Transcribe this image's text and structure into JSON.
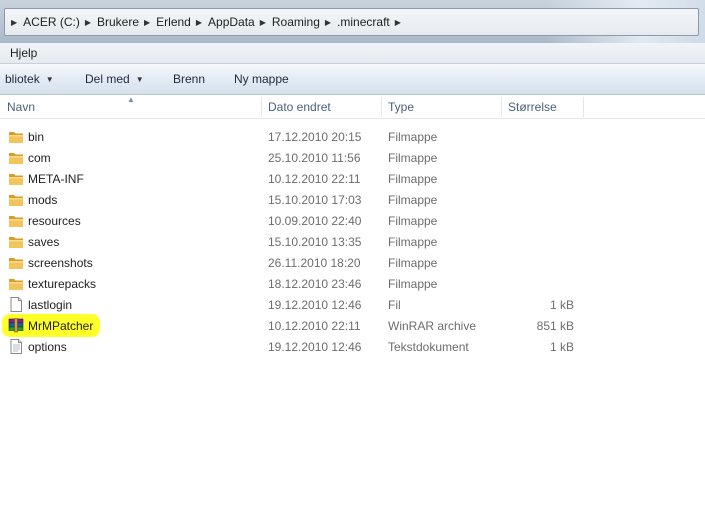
{
  "address_bar": {
    "crumbs": [
      "ACER (C:)",
      "Brukere",
      "Erlend",
      "AppData",
      "Roaming",
      ".minecraft"
    ]
  },
  "menu": {
    "items": [
      "Hjelp"
    ]
  },
  "toolbar": {
    "library_label": "bliotek",
    "share_label": "Del med",
    "burn_label": "Brenn",
    "new_folder_label": "Ny mappe"
  },
  "columns": {
    "name": "Navn",
    "date": "Dato endret",
    "type": "Type",
    "size": "Størrelse"
  },
  "files": [
    {
      "name": "bin",
      "date": "17.12.2010 20:15",
      "type": "Filmappe",
      "size": "",
      "icon": "folder-icon"
    },
    {
      "name": "com",
      "date": "25.10.2010 11:56",
      "type": "Filmappe",
      "size": "",
      "icon": "folder-icon"
    },
    {
      "name": "META-INF",
      "date": "10.12.2010 22:11",
      "type": "Filmappe",
      "size": "",
      "icon": "folder-icon"
    },
    {
      "name": "mods",
      "date": "15.10.2010 17:03",
      "type": "Filmappe",
      "size": "",
      "icon": "folder-icon"
    },
    {
      "name": "resources",
      "date": "10.09.2010 22:40",
      "type": "Filmappe",
      "size": "",
      "icon": "folder-icon"
    },
    {
      "name": "saves",
      "date": "15.10.2010 13:35",
      "type": "Filmappe",
      "size": "",
      "icon": "folder-icon"
    },
    {
      "name": "screenshots",
      "date": "26.11.2010 18:20",
      "type": "Filmappe",
      "size": "",
      "icon": "folder-icon"
    },
    {
      "name": "texturepacks",
      "date": "18.12.2010 23:46",
      "type": "Filmappe",
      "size": "",
      "icon": "folder-icon"
    },
    {
      "name": "lastlogin",
      "date": "19.12.2010 12:46",
      "type": "Fil",
      "size": "1 kB",
      "icon": "file-icon"
    },
    {
      "name": "MrMPatcher",
      "date": "10.12.2010 22:11",
      "type": "WinRAR archive",
      "size": "851 kB",
      "icon": "winrar-archive-icon",
      "highlighted": true
    },
    {
      "name": "options",
      "date": "19.12.2010 12:46",
      "type": "Tekstdokument",
      "size": "1 kB",
      "icon": "text-document-icon"
    }
  ],
  "colors": {
    "highlight": "#ffff1e",
    "folder": "#e8b64a",
    "header_text": "#4c607a"
  }
}
